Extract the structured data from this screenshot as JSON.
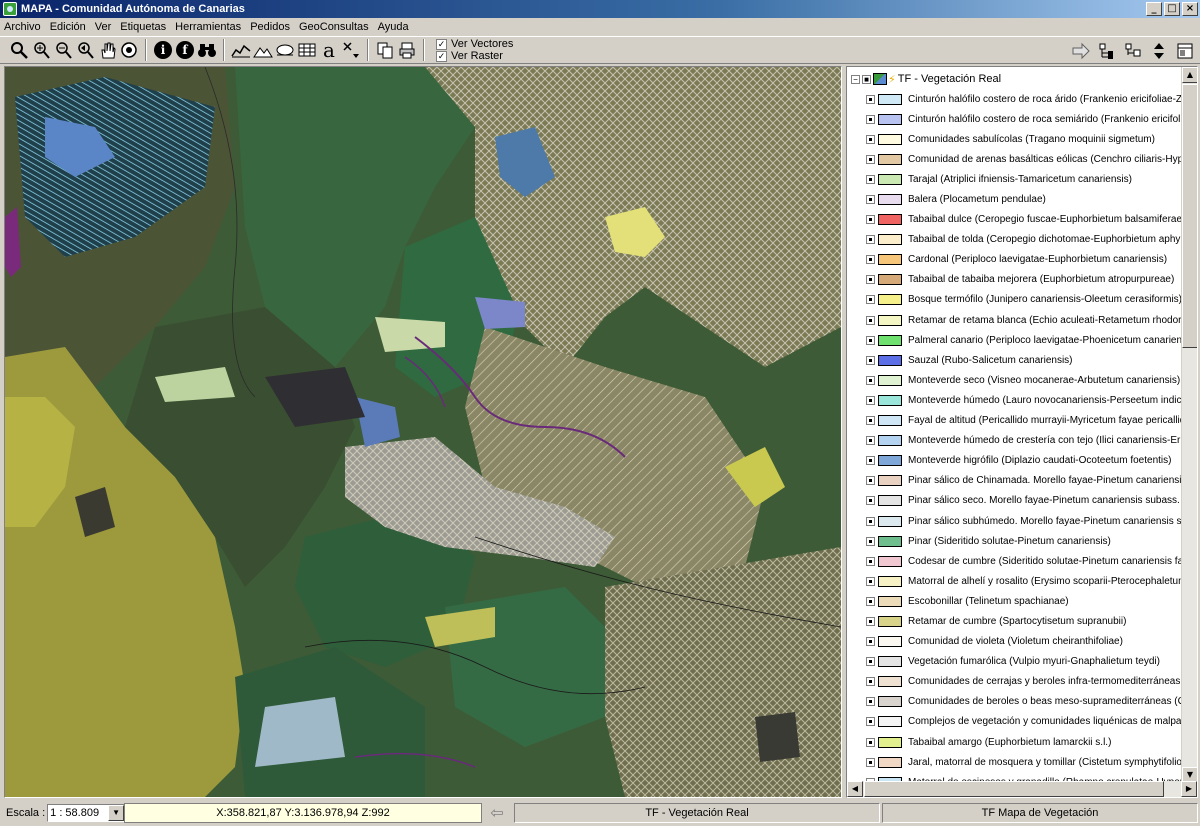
{
  "window": {
    "title": "MAPA - Comunidad Autónoma de Canarias",
    "buttons": [
      "_",
      "□",
      "×"
    ]
  },
  "menu": [
    "Archivo",
    "Edición",
    "Ver",
    "Etiquetas",
    "Herramientas",
    "Pedidos",
    "GeoConsultas",
    "Ayuda"
  ],
  "toolbar": {
    "ver_vectores": "Ver Vectores",
    "ver_raster": "Ver Raster",
    "text_tool": "a",
    "info_label": "i",
    "feature_info_label": "f"
  },
  "legend": {
    "root": "TF - Vegetación Real",
    "items": [
      {
        "label": "Cinturón halófilo costero de roca árido (Frankenio ericifoliae-Zygophylle",
        "color": "#cfe9f7"
      },
      {
        "label": "Cinturón halófilo costero de roca semiárido (Frankenio ericifoliae-Astyda",
        "color": "#b9c3f2"
      },
      {
        "label": "Comunidades sabulícolas (Tragano moquinii sigmetum)",
        "color": "#fffbe0"
      },
      {
        "label": "Comunidad de arenas basálticas eólicas (Cenchro ciliaris-Hyparrhenieti",
        "color": "#e3c9a3"
      },
      {
        "label": "Tarajal (Atriplici ifniensis-Tamaricetum canariensis)",
        "color": "#cbe9b3"
      },
      {
        "label": "Balera (Plocametum pendulae)",
        "color": "#eadcef"
      },
      {
        "label": "Tabaibal dulce (Ceropegio fuscae-Euphorbietum balsamiferae)",
        "color": "#f06464"
      },
      {
        "label": "Tabaibal de tolda (Ceropegio dichotomae-Euphorbietum aphyllae)",
        "color": "#fdeecb"
      },
      {
        "label": "Cardonal (Periploco laevigatae-Euphorbietum canariensis)",
        "color": "#f6c77b"
      },
      {
        "label": "Tabaibal de tabaiba mejorera (Euphorbietum atropurpureae)",
        "color": "#d6a978"
      },
      {
        "label": "Bosque termófilo (Junipero canariensis-Oleetum cerasiformis)",
        "color": "#f5f08a"
      },
      {
        "label": "Retamar de retama blanca (Echio aculeati-Retametum rhodorhizoidis)",
        "color": "#f4f6c4"
      },
      {
        "label": "Palmeral canario (Periploco laevigatae-Phoenicetum canariensis)",
        "color": "#6ee16e"
      },
      {
        "label": "Sauzal (Rubo-Salicetum canariensis)",
        "color": "#5c6fe6"
      },
      {
        "label": "Monteverde seco (Visneo mocanerae-Arbutetum canariensis)",
        "color": "#dff3d2"
      },
      {
        "label": "Monteverde húmedo (Lauro novocanariensis-Perseetum indicae)",
        "color": "#9ae6da"
      },
      {
        "label": "Fayal de altitud (Pericallido murrayii-Myricetum fayae pericallidetosum c",
        "color": "#cfe6f6"
      },
      {
        "label": "Monteverde húmedo de crestería con tejo (Ilici canariensis-Ericetum pl",
        "color": "#b4d3f0"
      },
      {
        "label": "Monteverde higrófilo (Diplazio caudati-Ocoteetum foetentis)",
        "color": "#7fa7d8"
      },
      {
        "label": "Pinar sálico de Chinamada. Morello fayae-Pinetum canariensis subass.",
        "color": "#e9d2c2"
      },
      {
        "label": "Pinar sálico seco. Morello fayae-Pinetum canariensis subass. arbutetos",
        "color": "#e4e4e4"
      },
      {
        "label": "Pinar sálico subhúmedo. Morello fayae-Pinetum canariensis subass. Ty",
        "color": "#dceaf0"
      },
      {
        "label": "Pinar (Sideritido solutae-Pinetum canariensis)",
        "color": "#6fbf8e"
      },
      {
        "label": "Codesar de cumbre (Sideritido solutae-Pinetum canariensis facies de A",
        "color": "#f1c7d2"
      },
      {
        "label": "Matorral de alhelí y rosalito (Erysimo scoparii-Pterocephaletum lasiospe",
        "color": "#f7f2c6"
      },
      {
        "label": "Escobonillar (Telinetum spachianae)",
        "color": "#eddcb9"
      },
      {
        "label": "Retamar de cumbre (Spartocytisetum supranubii)",
        "color": "#d8d58a"
      },
      {
        "label": "Comunidad de violeta (Violetum cheiranthifoliae)",
        "color": "#fbf7f1"
      },
      {
        "label": "Vegetación fumarólica (Vulpio myuri-Gnaphalietum teydi)",
        "color": "#e5e5e5"
      },
      {
        "label": "Comunidades de cerrajas y beroles infra-termomediterráneas (Soncho-",
        "color": "#f0e2d2"
      },
      {
        "label": "Comunidades de beroles o beas meso-supramediterráneas (Greenovior",
        "color": "#d9d4ce"
      },
      {
        "label": "Complejos de vegetación y comunidades liquénicas de malpaíses recie",
        "color": "#f4f4f4"
      },
      {
        "label": "Tabaibal amargo (Euphorbietum lamarckii s.l.)",
        "color": "#e3f08e"
      },
      {
        "label": "Jaral, matorral de mosquera y tomillar (Cistetum symphytifolio-monspelie",
        "color": "#f0d8c4"
      },
      {
        "label": "Matorral de escineses y granadillo (Rhamno crenulatae-Hypericetum ca",
        "color": "#c9e6f5"
      }
    ]
  },
  "status": {
    "scale_label": "Escala :",
    "scale_value": "1 : 58.809",
    "coords": "X:358.821,87  Y:3.136.978,94  Z:992",
    "layer": "TF - Vegetación Real",
    "map_name": "TF Mapa de Vegetación"
  }
}
